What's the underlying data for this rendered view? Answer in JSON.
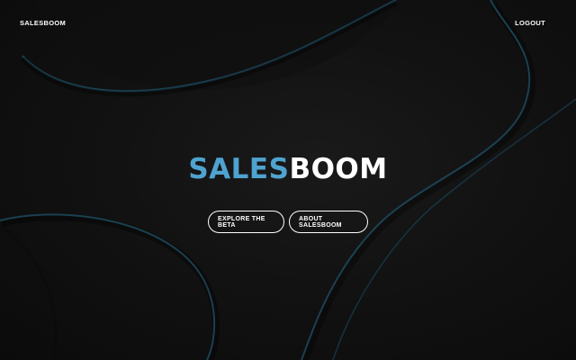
{
  "header": {
    "brand": "SALESBOOM",
    "logout_label": "LOGOUT"
  },
  "hero": {
    "title_part_1": "SALES",
    "title_part_2": "BOOM"
  },
  "actions": {
    "explore_label": "EXPLORE THE BETA",
    "about_label": "ABOUT SALESBOOM"
  },
  "colors": {
    "accent": "#4ea3cf",
    "background": "#0d0d0d",
    "text": "#ffffff",
    "wave_stroke": "#1e4a5e"
  }
}
